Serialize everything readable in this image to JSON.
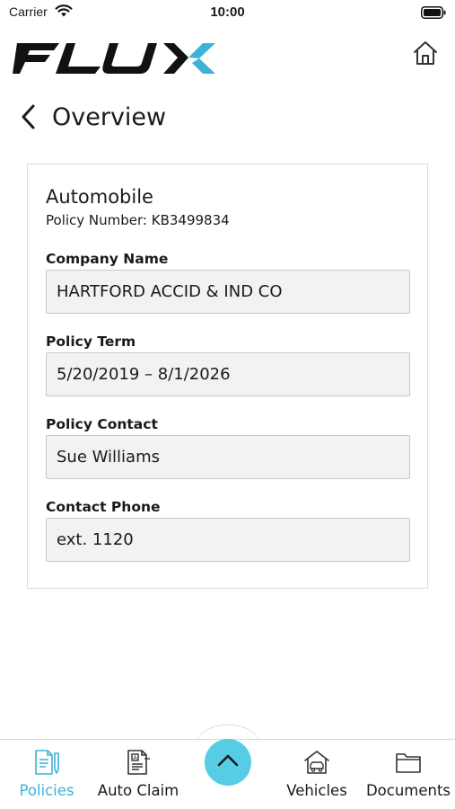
{
  "status_bar": {
    "carrier": "Carrier",
    "time": "10:00"
  },
  "header": {
    "logo_text": "FLUX"
  },
  "nav": {
    "title": "Overview"
  },
  "policy": {
    "type": "Automobile",
    "number_text": "Policy Number: KB3499834",
    "fields": [
      {
        "label": "Company Name",
        "value": "HARTFORD ACCID & IND CO"
      },
      {
        "label": "Policy Term",
        "value": "5/20/2019 – 8/1/2026"
      },
      {
        "label": "Policy Contact",
        "value": "Sue Williams"
      },
      {
        "label": "Contact Phone",
        "value": "ext. 1120"
      }
    ]
  },
  "tab_bar": {
    "tabs": [
      {
        "label": "Policies",
        "icon": "policy-document-icon",
        "active": true
      },
      {
        "label": "Auto Claim",
        "icon": "claim-form-icon",
        "active": false
      },
      {
        "label": "Vehicles",
        "icon": "car-garage-icon",
        "active": false
      },
      {
        "label": "Documents",
        "icon": "folder-icon",
        "active": false
      }
    ],
    "center_icon": "chevron-up-icon"
  },
  "colors": {
    "accent": "#3bb3d9",
    "center_button": "#57cde5",
    "field_bg": "#f2f2f2"
  }
}
